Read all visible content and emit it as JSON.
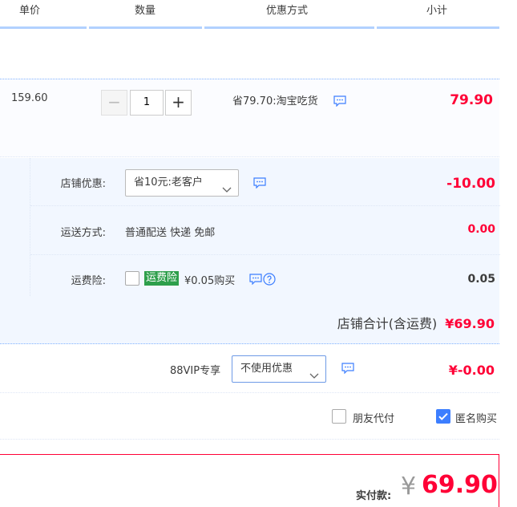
{
  "header": {
    "unit_price": "单价",
    "quantity": "数量",
    "discount_method": "优惠方式",
    "subtotal": "小计"
  },
  "item": {
    "price": "159.60",
    "quantity": "1",
    "minus_symbol": "−",
    "plus_symbol": "+",
    "promo": "省79.70:淘宝吃货",
    "subtotal": "79.90"
  },
  "shop": {
    "discount_label": "店铺优惠:",
    "discount_select": "省10元:老客户",
    "discount_amount": "-10.00",
    "shipping_label": "运送方式:",
    "shipping_text": "普通配送 快递 免邮",
    "shipping_amount": "0.00",
    "insurance_label": "运费险:",
    "insurance_tag": "运费险",
    "insurance_text": "¥0.05购买",
    "insurance_amount": "0.05",
    "total_label": "店铺合计(含运费)",
    "total_amount": "¥69.90"
  },
  "vip": {
    "label": "88VIP专享",
    "select": "不使用优惠",
    "amount": "¥-0.00"
  },
  "options": {
    "friend_pay": "朋友代付",
    "friend_pay_checked": false,
    "anonymous": "匿名购买",
    "anonymous_checked": true
  },
  "payment": {
    "label": "实付款:",
    "currency": "¥",
    "amount": "69.90"
  },
  "colors": {
    "accent_red": "#ff0036",
    "header_bar": "#b2d1ff",
    "shop_bg": "#f2f7ff",
    "tag_green": "#2e9f4b",
    "check_blue": "#3c7eff"
  }
}
